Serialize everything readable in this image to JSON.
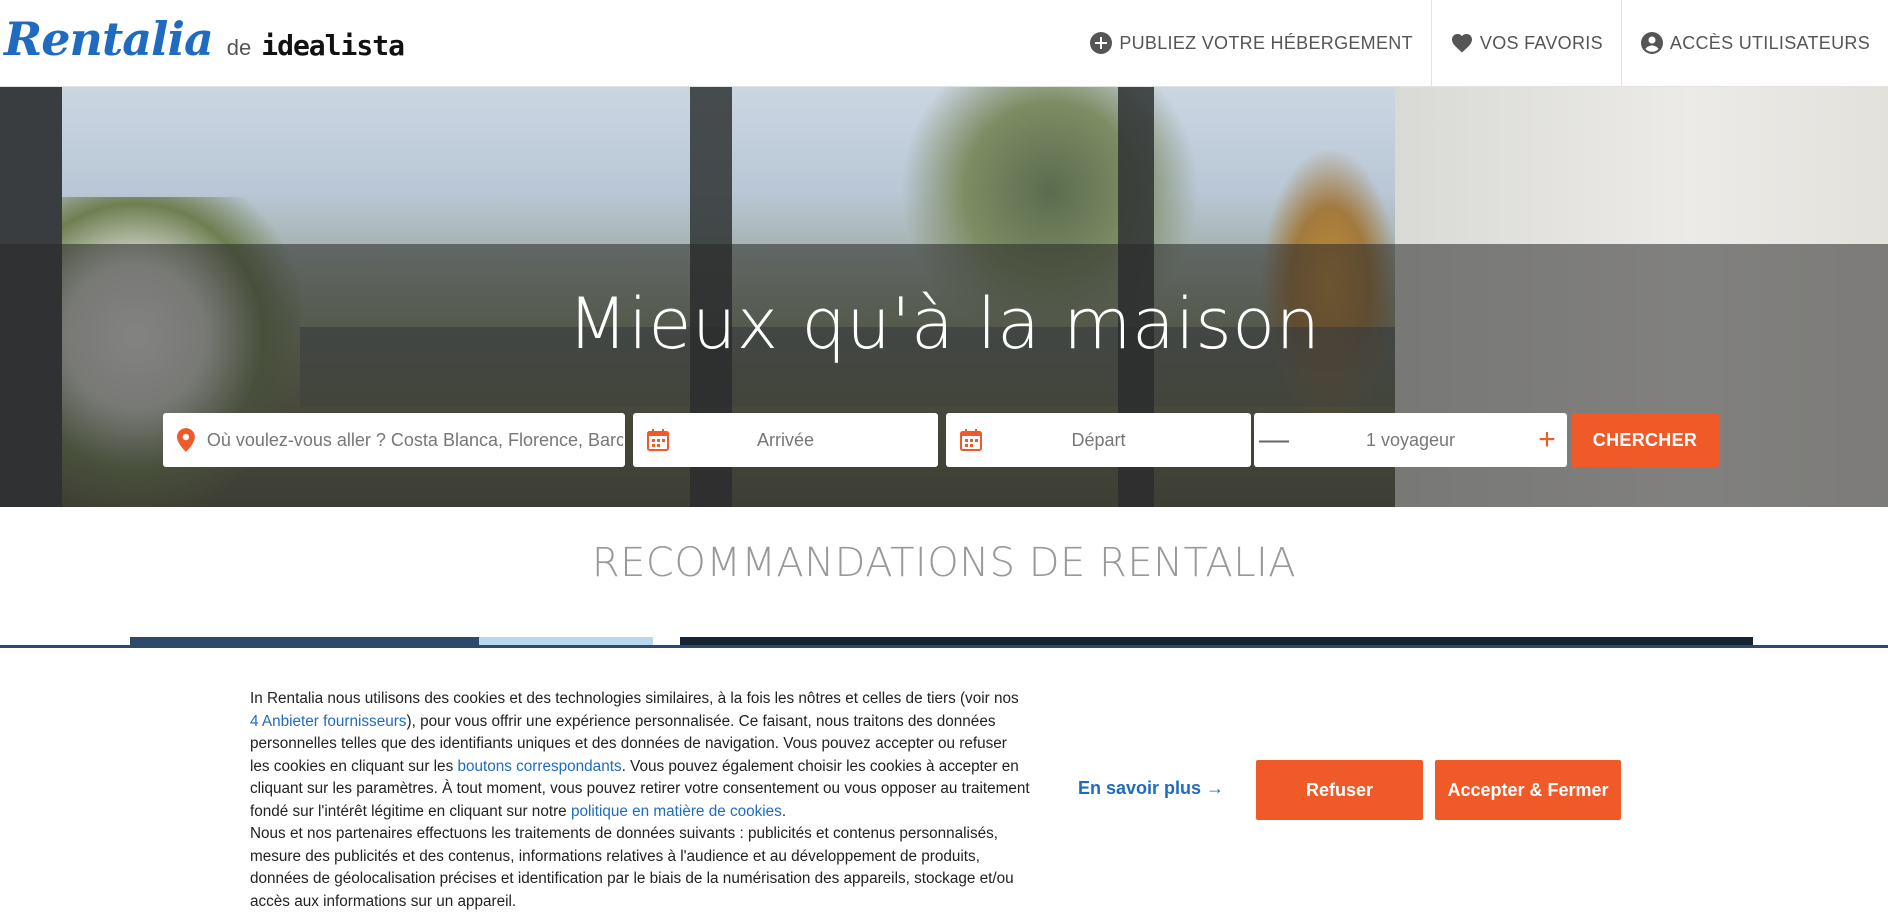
{
  "header": {
    "logo_main": "Rentalia",
    "logo_de": "de",
    "logo_partner": "idealista",
    "nav": [
      {
        "label": "PUBLIEZ VOTRE HÉBERGEMENT",
        "icon": "plus-circle-icon"
      },
      {
        "label": "VOS FAVORIS",
        "icon": "heart-icon"
      },
      {
        "label": "ACCÈS UTILISATEURS",
        "icon": "user-circle-icon"
      }
    ]
  },
  "hero": {
    "title": "Mieux qu'à la maison"
  },
  "search": {
    "destination_placeholder": "Où voulez-vous aller ? Costa Blanca, Florence, Barc...",
    "arrival_label": "Arrivée",
    "departure_label": "Départ",
    "travelers_label": "1 voyageur",
    "minus": "—",
    "plus": "+",
    "submit_label": "CHERCHER"
  },
  "recommendations": {
    "title": "RECOMMANDATIONS DE RENTALIA"
  },
  "cookie_banner": {
    "p1_a": "In Rentalia nous utilisons des cookies et des technologies similaires, à la fois les nôtres et celles de tiers (voir nos ",
    "p1_link1": "4 Anbieter fournisseurs",
    "p1_b": "), pour vous offrir une expérience personnalisée. Ce faisant, nous traitons des données personnelles telles que des identifiants uniques et des données de navigation. Vous pouvez accepter ou refuser les cookies en cliquant sur les ",
    "p1_link2": "boutons correspondants",
    "p1_c": ". Vous pouvez également choisir les cookies à accepter en cliquant sur les paramètres. À tout moment, vous pouvez retirer votre consentement ou vous opposer au traitement fondé sur l'intérêt légitime en cliquant sur notre ",
    "p1_link3": "politique en matière de cookies",
    "p1_d": ".",
    "p2": "Nous et nos partenaires effectuons les traitements de données suivants : publicités et contenus personnalisés, mesure des publicités et des contenus, informations relatives à l'audience et au développement de produits, données de géolocalisation précises et identification par le biais de la numérisation des appareils, stockage et/ou accès aux informations sur un appareil.",
    "more_link": "En savoir plus →",
    "refuse_label": "Refuser",
    "accept_label": "Accepter & Fermer"
  },
  "colors": {
    "brand_blue": "#1f6bc1",
    "accent_orange": "#f05a28",
    "banner_border": "#2c4a6b"
  }
}
